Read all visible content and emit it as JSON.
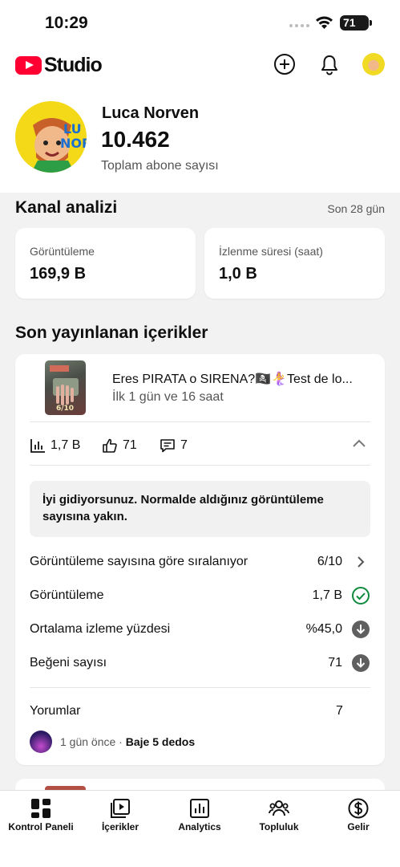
{
  "status_bar": {
    "time": "10:29",
    "battery": "71"
  },
  "header": {
    "brand": "Studio"
  },
  "channel": {
    "name": "Luca Norven",
    "subscribers": "10.462",
    "subscribers_label": "Toplam abone sayısı"
  },
  "analytics": {
    "title": "Kanal analizi",
    "period": "Son 28 gün",
    "metrics": [
      {
        "label": "Görüntüleme",
        "value": "169,9 B"
      },
      {
        "label": "İzlenme süresi (saat)",
        "value": "1,0 B"
      }
    ]
  },
  "recent": {
    "title": "Son yayınlanan içerikler",
    "video": {
      "title": "Eres PIRATA o SIRENA?🏴‍☠️🧜‍♀️Test de lo...",
      "subtitle": "İlk 1 gün ve 16 saat",
      "stats": {
        "views": "1,7 B",
        "likes": "71",
        "comments": "7"
      },
      "notice": "İyi gidiyorsunuz. Normalde aldığınız görüntüleme sayısına yakın.",
      "rows": [
        {
          "label": "Görüntüleme sayısına göre sıralanıyor",
          "value": "6/10",
          "icon": "chevron-right-icon"
        },
        {
          "label": "Görüntüleme",
          "value": "1,7 B",
          "icon": "check-circle-icon"
        },
        {
          "label": "Ortalama izleme yüzdesi",
          "value": "%45,0",
          "icon": "down-arrow-circle-icon"
        },
        {
          "label": "Beğeni sayısı",
          "value": "71",
          "icon": "down-arrow-circle-icon"
        }
      ],
      "comments_label": "Yorumlar",
      "comments_count": "7",
      "last_comment_time": "1 gün önce",
      "last_comment_author": "Baje 5 dedos"
    }
  },
  "bottom_nav": [
    {
      "label": "Kontrol Paneli",
      "icon": "dashboard-icon",
      "active": true
    },
    {
      "label": "İçerikler",
      "icon": "content-icon",
      "active": false
    },
    {
      "label": "Analytics",
      "icon": "analytics-icon",
      "active": false
    },
    {
      "label": "Topluluk",
      "icon": "community-icon",
      "active": false
    },
    {
      "label": "Gelir",
      "icon": "earn-icon",
      "active": false
    }
  ],
  "colors": {
    "brand_red": "#ff0033",
    "success_green": "#0f8a3c",
    "text_secondary": "#555555"
  }
}
